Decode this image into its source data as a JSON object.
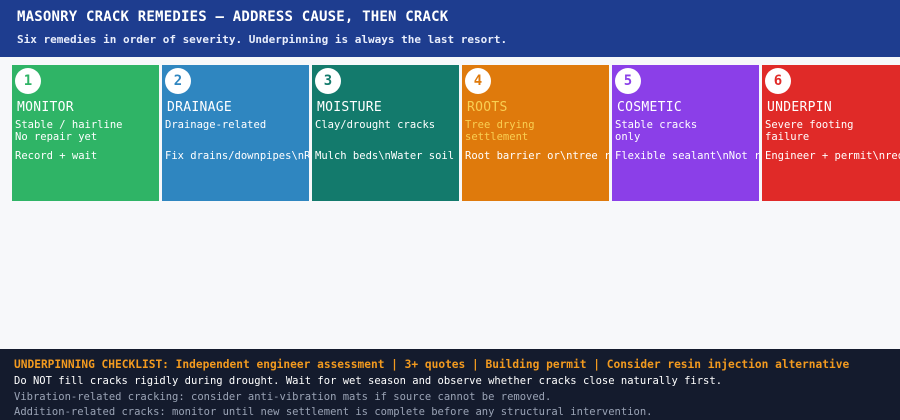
{
  "header": {
    "title": "MASONRY CRACK REMEDIES — ADDRESS CAUSE, THEN CRACK",
    "subtitle": "Six remedies in order of severity. Underpinning is always the last resort."
  },
  "cards": [
    {
      "num": "1",
      "title": "MONITOR",
      "desc": "Stable / hairline\nNo repair yet",
      "action": "Record + wait",
      "color": "#2fb466"
    },
    {
      "num": "2",
      "title": "DRAINAGE",
      "desc": "Drainage-related",
      "action": "Fix drains/downpipes\\nRa",
      "color": "#2f86c0"
    },
    {
      "num": "3",
      "title": "MOISTURE",
      "desc": "Clay/drought cracks",
      "action": "Mulch beds\\nWater soil m",
      "color": "#137a6c"
    },
    {
      "num": "4",
      "title": "ROOTS",
      "desc": "Tree drying\nsettlement",
      "action": "Root barrier or\\ntree re",
      "color": "#df7a0c",
      "accent": "#f9cf52"
    },
    {
      "num": "5",
      "title": "COSMETIC",
      "desc": "Stable cracks\nonly",
      "action": "Flexible sealant\\nNot ri",
      "color": "#8b3fe8"
    },
    {
      "num": "6",
      "title": "UNDERPIN",
      "desc": "Severe footing\nfailure",
      "action": "Engineer + permit\\nreq",
      "color": "#e02a28"
    }
  ],
  "footer": {
    "checklist": "UNDERPINNING CHECKLIST: Independent engineer assessment | 3+ quotes | Building permit | Consider resin injection alternative",
    "line1": "Do NOT fill cracks rigidly during drought. Wait for wet season and observe whether cracks close naturally first.",
    "line2": "Vibration-related cracking: consider anti-vibration mats if source cannot be removed.",
    "line3": "Addition-related cracks: monitor until new settlement is complete before any structural intervention."
  },
  "colors": {
    "header_bg": "#1e3d8f",
    "footer_bg": "#141b2d",
    "checklist": "#f29a1f"
  }
}
